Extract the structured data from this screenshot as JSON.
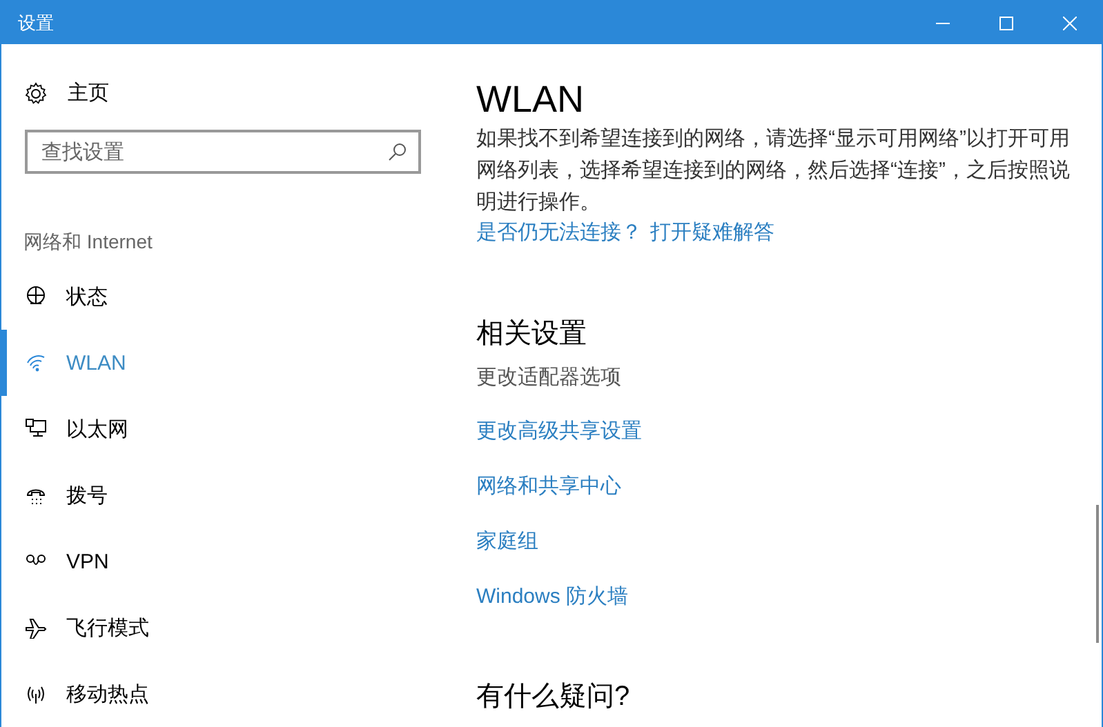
{
  "window": {
    "title": "设置"
  },
  "sidebar": {
    "home": "主页",
    "search": {
      "placeholder": "查找设置"
    },
    "section": "网络和 Internet",
    "items": [
      {
        "label": "状态",
        "kind": "status",
        "selected": false
      },
      {
        "label": "WLAN",
        "kind": "wifi",
        "selected": true
      },
      {
        "label": "以太网",
        "kind": "ethernet",
        "selected": false
      },
      {
        "label": "拨号",
        "kind": "dialup",
        "selected": false
      },
      {
        "label": "VPN",
        "kind": "vpn",
        "selected": false
      },
      {
        "label": "飞行模式",
        "kind": "airplane",
        "selected": false
      },
      {
        "label": "移动热点",
        "kind": "hotspot",
        "selected": false
      }
    ]
  },
  "content": {
    "title": "WLAN",
    "description": "如果找不到希望连接到的网络，请选择“显示可用网络”以打开可用网络列表，选择希望连接到的网络，然后选择“连接”，之后按照说明进行操作。",
    "help": [
      "是否仍无法连接？",
      "打开疑难解答"
    ],
    "related": {
      "title": "相关设置",
      "links": [
        {
          "label": "更改适配器选项",
          "disabled": true
        },
        {
          "label": "更改高级共享设置",
          "disabled": false
        },
        {
          "label": "网络和共享中心",
          "disabled": false
        },
        {
          "label": "家庭组",
          "disabled": false
        },
        {
          "label": "Windows 防火墙",
          "disabled": false
        }
      ]
    },
    "questions": {
      "title": "有什么疑问?"
    }
  }
}
